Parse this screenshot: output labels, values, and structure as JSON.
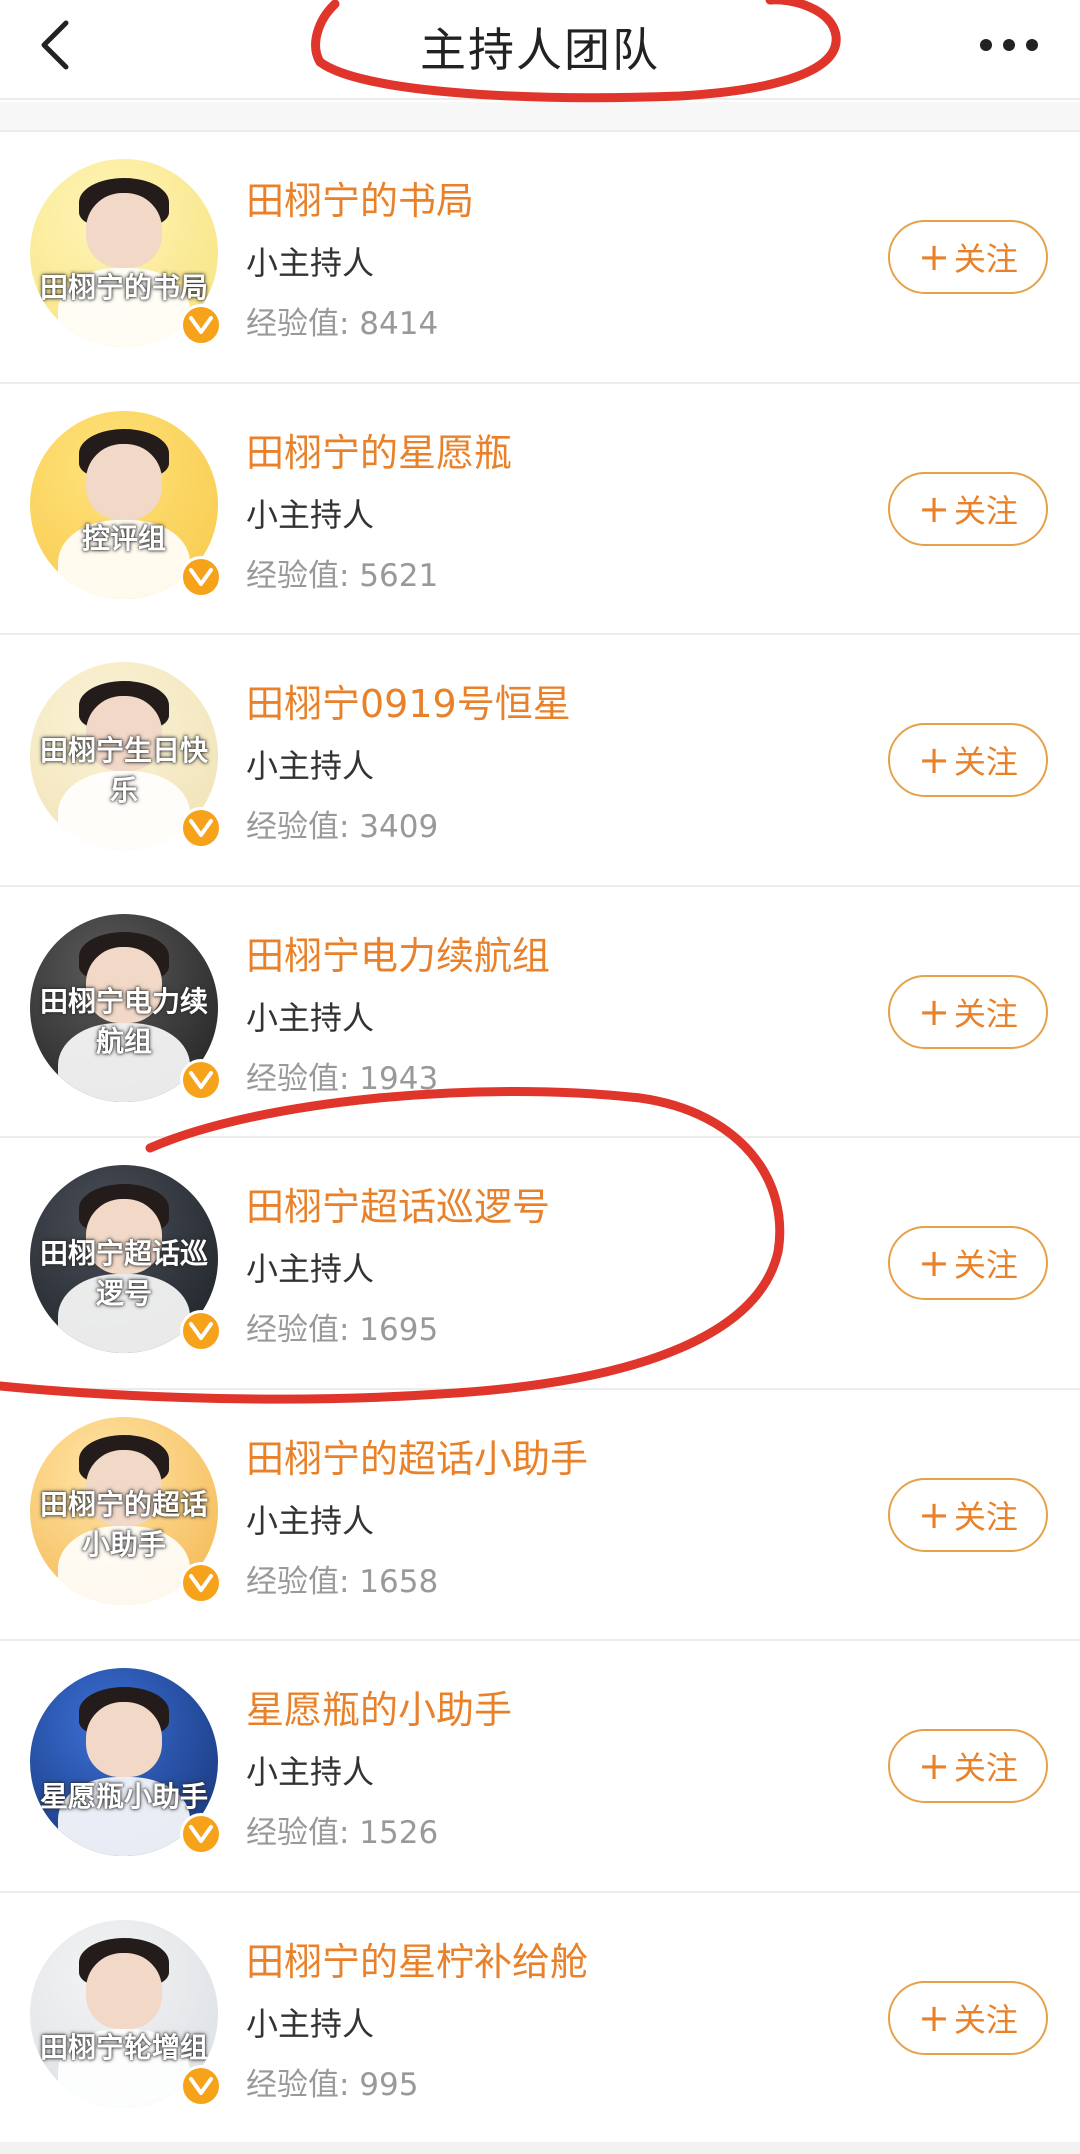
{
  "header": {
    "title": "主持人团队",
    "back_icon": "chevron-left-icon",
    "more_icon": "more-dots-icon"
  },
  "hosts": [
    {
      "name": "田栩宁的书局",
      "role": "小主持人",
      "exp_label": "经验值: 8414",
      "avatar_caption": "田栩宁的书局",
      "avatar_bg": [
        "#fff4b8",
        "#f6e27a"
      ],
      "follow_label": "关注"
    },
    {
      "name": "田栩宁的星愿瓶",
      "role": "小主持人",
      "exp_label": "经验值: 5621",
      "avatar_caption": "控评组",
      "avatar_bg": [
        "#ffe27a",
        "#f7c84a"
      ],
      "follow_label": "关注"
    },
    {
      "name": "田栩宁0919号恒星",
      "role": "小主持人",
      "exp_label": "经验值: 3409",
      "avatar_caption": "田栩宁生日快乐",
      "avatar_bg": [
        "#fbf3d6",
        "#efe1b4"
      ],
      "follow_label": "关注"
    },
    {
      "name": "田栩宁电力续航组",
      "role": "小主持人",
      "exp_label": "经验值: 1943",
      "avatar_caption": "田栩宁电力续航组",
      "avatar_bg": [
        "#5b5b5b",
        "#1e1e1e"
      ],
      "follow_label": "关注"
    },
    {
      "name": "田栩宁超话巡逻号",
      "role": "小主持人",
      "exp_label": "经验值: 1695",
      "avatar_caption": "田栩宁超话巡逻号",
      "avatar_bg": [
        "#4a4f58",
        "#1b1e24"
      ],
      "follow_label": "关注"
    },
    {
      "name": "田栩宁的超话小助手",
      "role": "小主持人",
      "exp_label": "经验值: 1658",
      "avatar_caption": "田栩宁的超话小助手",
      "avatar_bg": [
        "#ffe6a8",
        "#f3b34a"
      ],
      "follow_label": "关注"
    },
    {
      "name": "星愿瓶的小助手",
      "role": "小主持人",
      "exp_label": "经验值: 1526",
      "avatar_caption": "星愿瓶小助手",
      "avatar_bg": [
        "#3b6fd6",
        "#13306e"
      ],
      "follow_label": "关注"
    },
    {
      "name": "田栩宁的星柠补给舱",
      "role": "小主持人",
      "exp_label": "经验值: 995",
      "avatar_caption": "田栩宁轮增组",
      "avatar_bg": [
        "#f4f4f4",
        "#d9dde3"
      ],
      "follow_label": "关注"
    }
  ],
  "colors": {
    "accent": "#e8812a",
    "badge": "#f7a21b",
    "annotation": "#e0352b"
  }
}
